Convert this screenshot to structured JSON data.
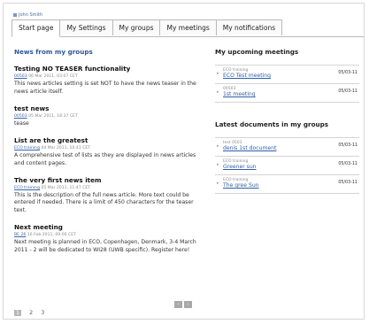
{
  "user": {
    "name": "John Smith"
  },
  "tabs": [
    {
      "label": "Start page",
      "active": true
    },
    {
      "label": "My Settings",
      "active": false
    },
    {
      "label": "My groups",
      "active": false
    },
    {
      "label": "My meetings",
      "active": false
    },
    {
      "label": "My notifications",
      "active": false
    }
  ],
  "news": {
    "title": "News from my groups",
    "items": [
      {
        "title": "Testing NO TEASER functionality",
        "source": "00503",
        "date": "06 Mar 2011, 03:07 CET",
        "text": "This news articles setting is set NOT to have the news teaser in the news article itself."
      },
      {
        "title": "test news",
        "source": "00503",
        "date": "05 Mar 2011, 18:37 CET",
        "text": "tease"
      },
      {
        "title": "List are the greatest",
        "source": "ECO training",
        "date": "04 Mar 2011, 10:41 CET",
        "text": "A comprehensive test of lists as they are displayed in news articles and content pages."
      },
      {
        "title": "The very first news item",
        "source": "ECO training",
        "date": "05 Mar 2011, 11:47 CET",
        "text": "This is the description of the full news article. More text could be entered if needed. There is a limit of 450 characters for the teaser text."
      },
      {
        "title": "Next meeting",
        "source": "BE 26",
        "date": "16 Feb 2011, 09:00 CET",
        "text": "Next meeting is planned in ECO, Copenhagen, Denmark, 3-4 March 2011 - 2 will be dedicated to WI28 (UWB specific). Register here!"
      }
    ],
    "pages": [
      "1",
      "2",
      "3"
    ],
    "prev": "‹",
    "next": "›"
  },
  "meetings": {
    "title": "My upcoming meetings",
    "items": [
      {
        "group": "ECO training",
        "title": "ECO Test meeting",
        "date": "05/03-11"
      },
      {
        "group": "00503",
        "title": "1st meeting",
        "date": "05/03-11"
      }
    ]
  },
  "documents": {
    "title": "Latest documents in my groups",
    "items": [
      {
        "group": "test 0503",
        "title": "denis 1st document",
        "date": "05/03-11"
      },
      {
        "group": "ECO training",
        "title": "Greener sun",
        "date": "05/03-11"
      },
      {
        "group": "ECO training",
        "title": "The gree Sun",
        "date": "05/03-11"
      }
    ]
  },
  "colors": {
    "link": "#2f5fa8",
    "section_title": "#2a5898"
  }
}
